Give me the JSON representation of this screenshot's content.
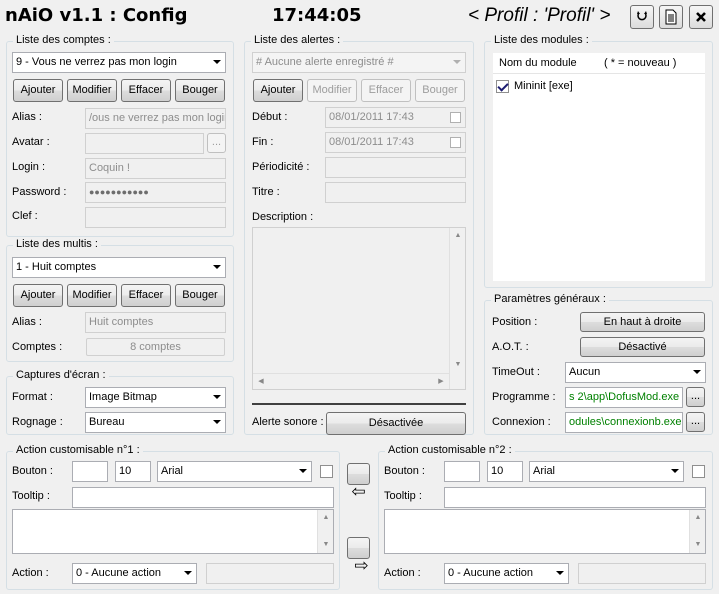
{
  "header": {
    "app_title": "nAiO v1.1 : Config",
    "clock": "17:44:05",
    "profile_prefix": "< Profil : ",
    "profile_name": "'Profil'",
    "profile_suffix": " >"
  },
  "comptes": {
    "legend": "Liste des comptes :",
    "selected": "9 - Vous ne verrez pas mon login",
    "buttons": [
      "Ajouter",
      "Modifier",
      "Effacer",
      "Bouger"
    ],
    "labels": {
      "alias": "Alias :",
      "avatar": "Avatar :",
      "login": "Login :",
      "password": "Password :",
      "clef": "Clef :"
    },
    "values": {
      "alias": "/ous ne verrez pas mon login",
      "avatar": "",
      "login": "Coquin !",
      "password": "●●●●●●●●●●●",
      "clef": ""
    },
    "browse": "..."
  },
  "multis": {
    "legend": "Liste des multis :",
    "selected": "1 - Huit comptes",
    "buttons": [
      "Ajouter",
      "Modifier",
      "Effacer",
      "Bouger"
    ],
    "labels": {
      "alias": "Alias :",
      "comptes": "Comptes :"
    },
    "values": {
      "alias": "Huit comptes",
      "comptes": "8 comptes"
    }
  },
  "captures": {
    "legend": "Captures d'écran :",
    "labels": {
      "format": "Format :",
      "rognage": "Rognage :"
    },
    "values": {
      "format": "Image Bitmap",
      "rognage": "Bureau"
    }
  },
  "alertes": {
    "legend": "Liste des alertes :",
    "selected": "# Aucune alerte enregistré #",
    "buttons": [
      "Ajouter",
      "Modifier",
      "Effacer",
      "Bouger"
    ],
    "labels": {
      "debut": "Début :",
      "fin": "Fin :",
      "periodicite": "Périodicité :",
      "titre": "Titre :",
      "description": "Description :",
      "alerte_sonore": "Alerte sonore :"
    },
    "values": {
      "debut": "08/01/2011 17:43",
      "fin": "08/01/2011 17:43",
      "periodicite": "",
      "titre": ""
    },
    "alerte_sonore_btn": "Désactivée"
  },
  "modules": {
    "legend": "Liste des modules :",
    "col_name": "Nom du module",
    "col_note": "( * = nouveau )",
    "items": [
      {
        "label": "Mininit [exe]",
        "checked": true
      }
    ]
  },
  "params": {
    "legend": "Paramètres généraux :",
    "labels": {
      "position": "Position :",
      "aot": "A.O.T. :",
      "timeout": "TimeOut :",
      "programme": "Programme :",
      "connexion": "Connexion :"
    },
    "values": {
      "position": "En haut à droite",
      "aot": "Désactivé",
      "timeout": "Aucun",
      "programme": "s 2\\app\\DofusMod.exe",
      "connexion": "odules\\connexionb.exe"
    },
    "browse": "..."
  },
  "action1": {
    "legend": "Action customisable n°1 :",
    "labels": {
      "bouton": "Bouton :",
      "tooltip": "Tooltip :",
      "action": "Action :"
    },
    "values": {
      "bouton": "",
      "size": "10",
      "font": "Arial",
      "tooltip": "",
      "action": "0 - Aucune action"
    }
  },
  "action2": {
    "legend": "Action customisable n°2 :",
    "labels": {
      "bouton": "Bouton :",
      "tooltip": "Tooltip :",
      "action": "Action :"
    },
    "values": {
      "bouton": "",
      "size": "10",
      "font": "Arial",
      "tooltip": "",
      "action": "0 - Aucune action"
    }
  },
  "transfer": {
    "left_arrow": "⇦",
    "right_arrow": "⇨"
  },
  "icons": {
    "refresh": "refresh-icon",
    "notes": "document-icon",
    "close": "close-icon"
  }
}
